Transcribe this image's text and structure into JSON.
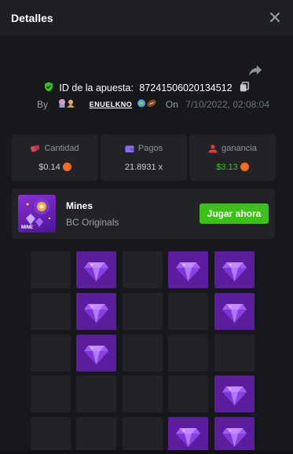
{
  "header": {
    "title": "Detalles"
  },
  "bet": {
    "id_label": "ID de la apuesta:",
    "id_value": "87241506020134512",
    "by_label": "By",
    "username": "ENUELKNO",
    "on_label": "On",
    "date": "7/10/2022, 02:08:04"
  },
  "stats": [
    {
      "label": "Cantidad",
      "value": "$0.14",
      "icon": "dice-icon",
      "coin": true
    },
    {
      "label": "Pagos",
      "value": "21.8931 x",
      "icon": "wallet-icon",
      "coin": false
    },
    {
      "label": "ganancia",
      "value": "$3.13",
      "icon": "profit-icon",
      "coin": true
    }
  ],
  "game": {
    "thumb_label": "MINE",
    "name": "Mines",
    "provider": "BC Originals",
    "play_label": "Jugar ahora"
  },
  "board": {
    "rows": [
      [
        0,
        1,
        0,
        1,
        1
      ],
      [
        0,
        1,
        0,
        0,
        1
      ],
      [
        0,
        1,
        0,
        0,
        0
      ],
      [
        0,
        0,
        0,
        0,
        1
      ],
      [
        0,
        0,
        0,
        1,
        1
      ]
    ]
  },
  "colors": {
    "accent_green": "#3bc117",
    "gem_tile": "#5b1c9d",
    "empty_tile": "#222327",
    "coin": "#f26b21"
  }
}
